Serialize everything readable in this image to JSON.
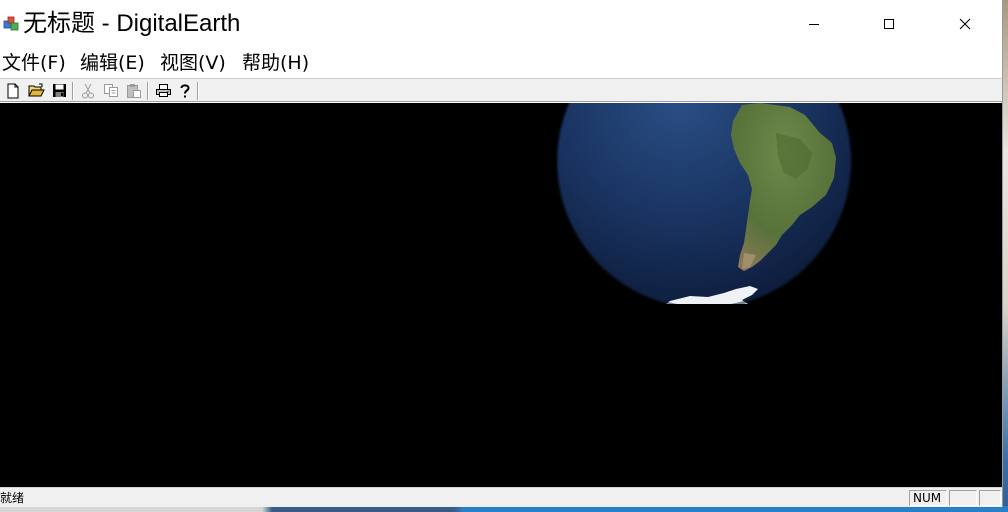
{
  "window": {
    "title": "无标题 - DigitalEarth",
    "controls": {
      "minimize_icon": "minimize-icon",
      "maximize_icon": "maximize-icon",
      "close_icon": "close-icon"
    }
  },
  "menu": {
    "items": [
      {
        "label": "文件(F)"
      },
      {
        "label": "编辑(E)"
      },
      {
        "label": "视图(V)"
      },
      {
        "label": "帮助(H)"
      }
    ]
  },
  "toolbar": {
    "buttons": [
      {
        "icon": "new-document-icon",
        "enabled": true
      },
      {
        "icon": "open-folder-icon",
        "enabled": true
      },
      {
        "icon": "save-icon",
        "enabled": true
      },
      {
        "icon": "cut-icon",
        "enabled": false
      },
      {
        "icon": "copy-icon",
        "enabled": false
      },
      {
        "icon": "paste-icon",
        "enabled": false
      },
      {
        "icon": "print-icon",
        "enabled": true
      },
      {
        "icon": "help-icon",
        "enabled": true
      }
    ]
  },
  "viewport": {
    "background": "#000000",
    "content": "globe-render"
  },
  "statusbar": {
    "text": "就绪",
    "indicators": [
      {
        "label": "NUM"
      },
      {
        "label": ""
      },
      {
        "label": ""
      }
    ]
  }
}
